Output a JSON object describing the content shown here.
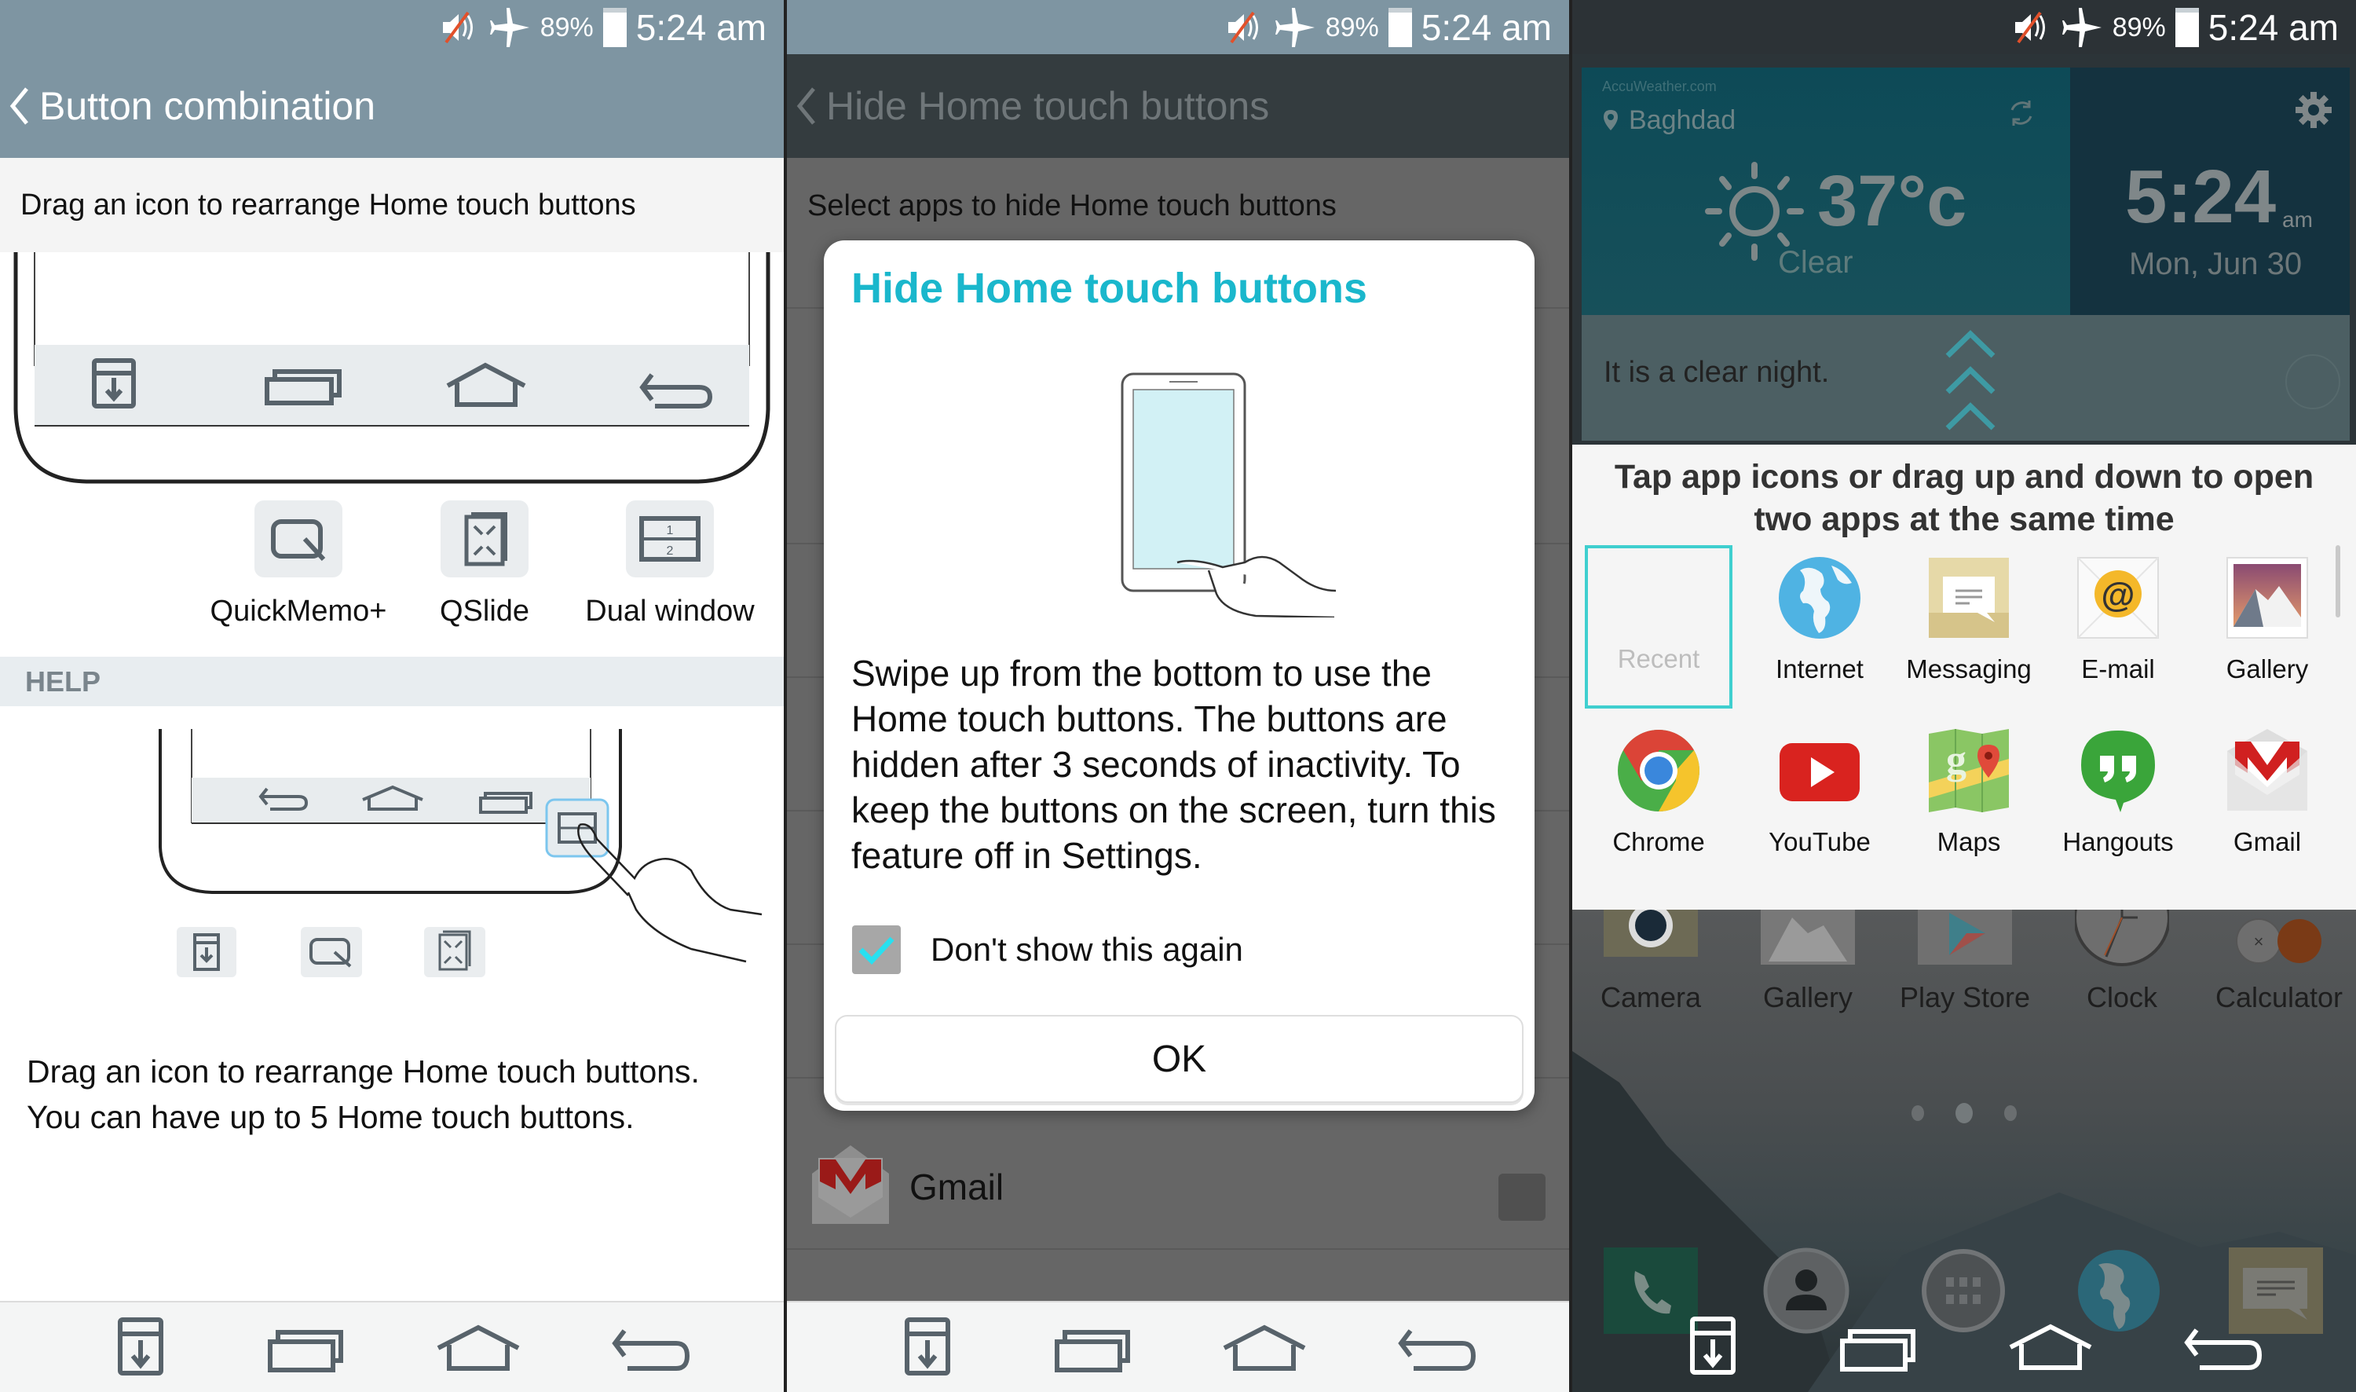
{
  "status_bar": {
    "battery_percent": "89%",
    "time": "5:24 am",
    "icons": [
      "mute-icon",
      "airplane-mode-icon",
      "battery-icon"
    ]
  },
  "panel1": {
    "title": "Button combination",
    "subtitle": "Drag an icon to rearrange Home touch buttons",
    "preview_buttons": [
      "notification-pull-icon",
      "recent-apps-icon",
      "home-icon",
      "back-icon"
    ],
    "options": [
      {
        "label": "QuickMemo+",
        "icon": "quickmemo-icon"
      },
      {
        "label": "QSlide",
        "icon": "qslide-icon"
      },
      {
        "label": "Dual window",
        "icon": "dual-window-icon"
      }
    ],
    "help_header": "HELP",
    "help_text_line1": "Drag an icon to rearrange Home touch buttons.",
    "help_text_line2": "You can have up to 5 Home touch buttons."
  },
  "panel2": {
    "title": "Hide Home touch buttons",
    "subtitle": "Select apps to hide Home touch buttons",
    "list_visible_item": {
      "label": "Gmail",
      "checked": false
    },
    "dialog": {
      "title": "Hide Home touch buttons",
      "body": "Swipe up from the bottom to use the Home touch buttons. The buttons are hidden after 3 seconds of inactivity. To keep the buttons on the screen, turn this feature off in Settings.",
      "checkbox_label": "Don't show this again",
      "checkbox_checked": true,
      "ok_label": "OK",
      "accent_color": "#1ab7cc"
    }
  },
  "panel3": {
    "weather": {
      "source": "AccuWeather.com",
      "city": "Baghdad",
      "temperature": "37°c",
      "condition": "Clear",
      "message": "It is a clear night."
    },
    "clock": {
      "time": "5:24",
      "ampm": "am",
      "date": "Mon, Jun 30"
    },
    "dual_window": {
      "instruction": "Tap app icons or drag up and down to open two apps at the same time",
      "recent_label": "Recent",
      "apps": [
        {
          "label": "Internet",
          "icon": "globe-icon"
        },
        {
          "label": "Messaging",
          "icon": "messaging-icon"
        },
        {
          "label": "E-mail",
          "icon": "email-icon"
        },
        {
          "label": "Gallery",
          "icon": "gallery-icon"
        },
        {
          "label": "Chrome",
          "icon": "chrome-icon"
        },
        {
          "label": "YouTube",
          "icon": "youtube-icon"
        },
        {
          "label": "Maps",
          "icon": "maps-icon"
        },
        {
          "label": "Hangouts",
          "icon": "hangouts-icon"
        },
        {
          "label": "Gmail",
          "icon": "gmail-icon"
        }
      ]
    },
    "home_apps": [
      {
        "label": "Camera"
      },
      {
        "label": "Gallery"
      },
      {
        "label": "Play Store"
      },
      {
        "label": "Clock"
      },
      {
        "label": "Calculator"
      }
    ],
    "dock": [
      "phone-icon",
      "contacts-icon",
      "apps-drawer-icon",
      "internet-icon",
      "messaging-icon"
    ],
    "page_indicator": {
      "pages": 3,
      "current": 2
    }
  },
  "nav_buttons": [
    "notification-pull-icon",
    "recent-apps-icon",
    "home-icon",
    "back-icon"
  ]
}
